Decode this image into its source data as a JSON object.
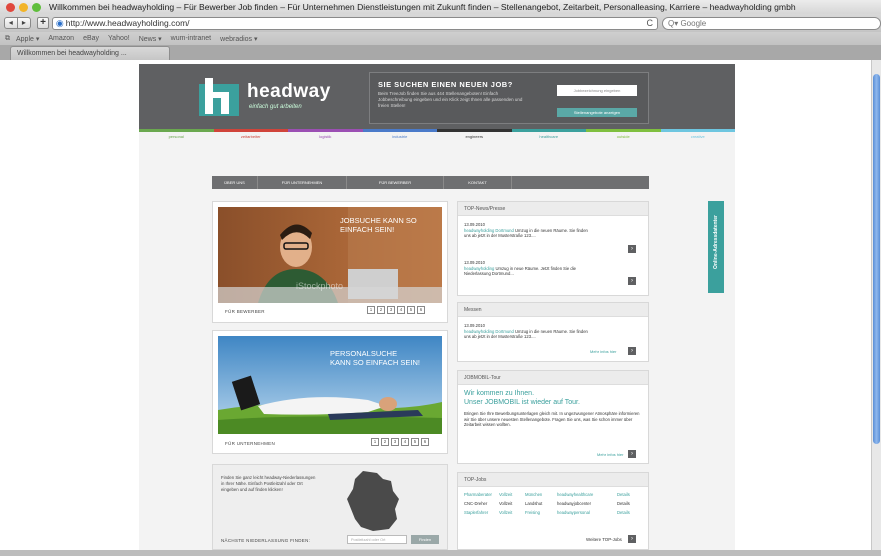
{
  "window": {
    "title": "Willkommen bei headwayholding – Für Bewerber Job finden – Für Unternehmen Dienstleistungen mit Zukunft finden – Stellenangebot, Zeitarbeit, Personalleasing, Karriere – headwayholding gmbh"
  },
  "toolbar": {
    "back": "◂",
    "forward": "▸",
    "add": "+",
    "url": "http://www.headwayholding.com/",
    "reload": "C",
    "search_placeholder": "Q▾ Google"
  },
  "bookmarks": [
    "Apple ▾",
    "Amazon",
    "eBay",
    "Yahoo!",
    "News ▾",
    "wum-intranet",
    "webradios ▾"
  ],
  "tab": {
    "label": "Willkommen bei headwayholding ..."
  },
  "site": {
    "logo": "headway",
    "tagline": "einfach gut arbeiten",
    "jobbox": {
      "title": "SIE SUCHEN EINEN NEUEN JOB?",
      "text": "Beim TreeJob finden Sie aus 444 Stellenangeboten! Einfach Jobbeschreibung eingeben und ein Klick zeigt Ihnen alle passenden und freien Stellen!",
      "input_placeholder": "Jobbezeichnung eingeben",
      "button": "Stellenangebote anzeigen"
    },
    "categories": [
      "personal",
      "zeitarbeiter",
      "logistik",
      "industrie",
      "engineers",
      "healthcare",
      "outside",
      "creative"
    ],
    "category_colors": [
      "#6aa84f",
      "#d0443a",
      "#9b4fb3",
      "#4a7ac9",
      "#333333",
      "#3ba09d",
      "#7fbf3f",
      "#6ec6e0"
    ],
    "main_nav": [
      "ÜBER UNS",
      "FÜR UNTERNEHMEN",
      "FÜR BEWERBER",
      "KONTAKT",
      ""
    ],
    "card1": {
      "headline": "JOBSUCHE KANN SO EINFACH SEIN!",
      "label": "FÜR BEWERBER",
      "watermark": "iStockphoto",
      "pages": [
        "1",
        "2",
        "3",
        "4",
        "5",
        "6"
      ]
    },
    "card2": {
      "headline": "PERSONALSUCHE KANN SO EINFACH SEIN!",
      "label": "FÜR UNTERNEHMEN",
      "pages": [
        "1",
        "2",
        "3",
        "4",
        "5",
        "6"
      ]
    },
    "card3": {
      "text": "Finden Sie ganz leicht headway-Niederlassungen in Ihrer Nähe. Einfach Postleitzahl oder Ort eingeben und auf finden klicken!",
      "label": "NÄCHSTE NIEDERLASSUNG FINDEN:",
      "input_placeholder": "Postleitzahl oder Ort",
      "button": "Finden"
    },
    "news": {
      "title": "TOP-News/Presse",
      "items": [
        {
          "date": "13.09.2010",
          "link": "headwayholding Dortmund",
          "text": "Umzug in die neuen Räume. Sie finden uns ab jetzt in der Musterstraße 123...."
        },
        {
          "date": "13.09.2010",
          "link": "headwayholding",
          "text": "Umzug in neue Räume. Jetzt finden Sie die Niederlassung Dortmund..."
        }
      ]
    },
    "messen": {
      "title": "Messen",
      "date": "13.09.2010",
      "link": "headwayholding Dortmund",
      "text": "Umzug in die neuen Räume. Sie finden uns ab jetzt in der Musterstraße 123....",
      "more": "Mehr infos hier"
    },
    "jobmobil": {
      "title": "JOBMOBIL-Tour",
      "headline1": "Wir kommen zu Ihnen.",
      "headline2": "Unser JOBMOBIL ist wieder auf Tour.",
      "text": "Bringen Sie Ihre Bewerbungsunterlagen gleich mit. In ungezwungener Atmosphäre informieren wir Sie über unsere neuesten Stellenangebote. Fragen Sie uns, was Sie schon immer über Zeitarbeit wissen wollten.",
      "more": "Mehr infos hier"
    },
    "topjobs": {
      "title": "TOP-Jobs",
      "rows": [
        [
          "Pharmaberater",
          "Vollzeit",
          "München",
          "headwayhealthcare",
          "Details"
        ],
        [
          "CNC-Dreher",
          "Vollzeit",
          "Landshut",
          "headwayjobcenter",
          "Details"
        ],
        [
          "Staplerfahrer",
          "Vollzeit",
          "Freising",
          "headwaypersonal",
          "Details"
        ]
      ],
      "more": "Weitere TOP-Jobs"
    },
    "promo_tab": "Online-Adressdatenter"
  }
}
